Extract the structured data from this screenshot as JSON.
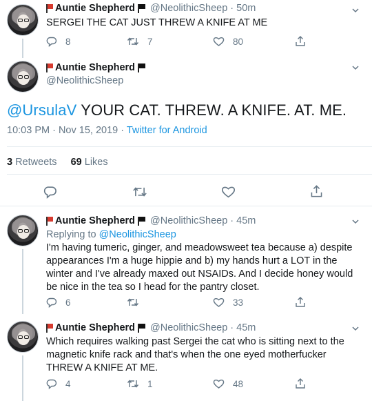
{
  "author": {
    "name": "Auntie Shepherd",
    "handle": "@NeolithicSheep"
  },
  "tweets": [
    {
      "time": "· 50m",
      "text": "SERGEI THE CAT JUST THREW A KNIFE AT ME",
      "replies": "8",
      "retweets": "7",
      "likes": "80"
    },
    {
      "time": "· 45m",
      "reply_prefix": "Replying to ",
      "reply_to": "@NeolithicSheep",
      "text": "I'm having tumeric, ginger, and meadowsweet tea because a) despite appearances I'm a huge hippie and b) my hands hurt a LOT in the winter and I've already maxed out NSAIDs. And I decide honey would be nice in the tea so I head for the pantry closet.",
      "replies": "6",
      "retweets": "",
      "likes": "33"
    },
    {
      "time": "· 45m",
      "text": "Which requires walking past Sergei the cat who is sitting next to the magnetic knife rack and that's when the one eyed motherfucker THREW A KNIFE AT ME.",
      "replies": "4",
      "retweets": "1",
      "likes": "48"
    }
  ],
  "main_tweet": {
    "mention": "@UrsulaV",
    "text": " YOUR CAT. THREW. A KNIFE. AT. ME.",
    "time": "10:03 PM · Nov 15, 2019 · ",
    "source": "Twitter for Android",
    "retweets_count": "3",
    "retweets_label": " Retweets",
    "likes_count": "69",
    "likes_label": " Likes"
  },
  "icons": [
    "reply-icon",
    "retweet-icon",
    "like-icon",
    "share-icon",
    "chevron-down-icon"
  ],
  "colors": {
    "link": "#1b95e0",
    "secondary": "#657786",
    "flag": "#d63a2f"
  }
}
